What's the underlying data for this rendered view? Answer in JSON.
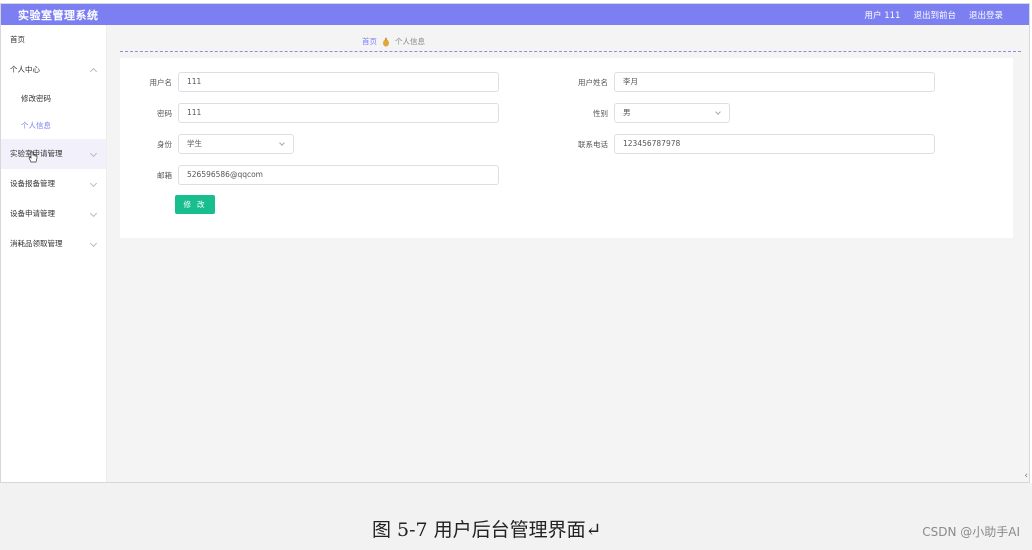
{
  "app": {
    "title": "实验室管理系统",
    "user_label": "用户 111",
    "back_to_front": "退出到前台",
    "logout": "退出登录"
  },
  "sidebar": {
    "items": [
      {
        "label": "首页"
      },
      {
        "label": "个人中心"
      },
      {
        "label": "修改密码"
      },
      {
        "label": "个人信息"
      },
      {
        "label": "实验室申请管理"
      },
      {
        "label": "设备报备管理"
      },
      {
        "label": "设备申请管理"
      },
      {
        "label": "消耗品领取管理"
      }
    ]
  },
  "breadcrumb": {
    "home": "首页",
    "current": "个人信息"
  },
  "form": {
    "username_label": "用户名",
    "username_value": "111",
    "realname_label": "用户姓名",
    "realname_value": "李月",
    "password_label": "密码",
    "password_value": "111",
    "gender_label": "性别",
    "gender_value": "男",
    "identity_label": "身份",
    "identity_value": "学生",
    "phone_label": "联系电话",
    "phone_value": "123456787978",
    "email_label": "邮箱",
    "email_value": "526596586@qqcom",
    "submit_label": "修 改"
  },
  "caption": {
    "text": "图 5-7 用户后台管理界面↵",
    "watermark": "CSDN @小助手AI"
  },
  "colors": {
    "accent": "#7b7ff2",
    "button": "#19be8f"
  }
}
